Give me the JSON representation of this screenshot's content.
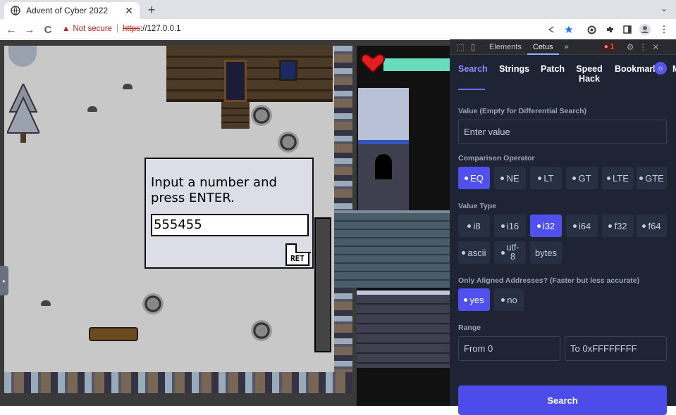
{
  "browser": {
    "tab_title": "Advent of Cyber 2022",
    "tab_close": "✕",
    "new_tab": "+",
    "tab_search": "⌄",
    "back": "←",
    "forward": "→",
    "reload": "C",
    "security_warning_icon": "▲",
    "security_text": "Not secure",
    "url_scheme": "https",
    "url_rest": "://127.0.0.1",
    "toolbar_icons": [
      "share-icon",
      "star-icon",
      "extension-1-icon",
      "extensions-icon",
      "sidepanel-icon",
      "profile-icon",
      "menu-icon"
    ]
  },
  "game": {
    "prompt": "Input a number and press ENTER.",
    "input_value": "555455",
    "ret_label": "RET",
    "health_level": 1.0
  },
  "devtools": {
    "tabs": [
      "Elements",
      "Cetus"
    ],
    "more_tabs": "»",
    "error_count": "1",
    "active_tab": "Cetus"
  },
  "cetus": {
    "nav": [
      "Search",
      "Strings",
      "Patch",
      "Speed Hack",
      "Bookmark"
    ],
    "nav_overflow": "M",
    "value_label": "Value (Empty for Differential Search)",
    "value_placeholder": "Enter value",
    "comparison_label": "Comparison Operator",
    "comparison_ops": [
      "EQ",
      "NE",
      "LT",
      "GT",
      "LTE",
      "GTE"
    ],
    "comparison_selected": "EQ",
    "value_type_label": "Value Type",
    "value_types": [
      "i8",
      "i16",
      "i32",
      "i64",
      "f32",
      "f64",
      "ascii",
      "utf-8",
      "bytes"
    ],
    "value_type_selected": "i32",
    "aligned_label": "Only Aligned Addresses? (Faster but less accurate)",
    "aligned_options": [
      "yes",
      "no"
    ],
    "aligned_selected": "yes",
    "range_label": "Range",
    "range_from": "From 0",
    "range_to": "To 0xFFFFFFFF",
    "search_button": "Search"
  },
  "colors": {
    "accent": "#5050ee",
    "panel_bg": "#1e2433",
    "not_secure": "#c5221f",
    "health": "#66ddbb"
  }
}
